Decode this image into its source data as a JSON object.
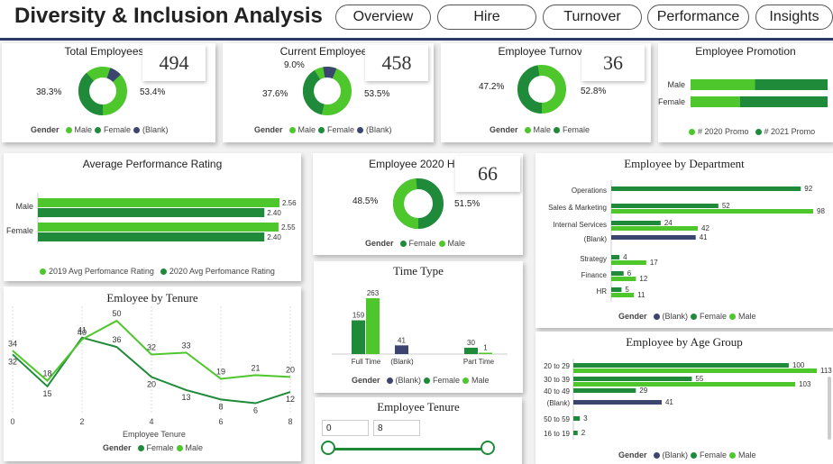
{
  "header": {
    "title": "Diversity & Inclusion Analysis",
    "tabs": [
      "Overview",
      "Hire",
      "Turnover",
      "Performance",
      "Insights"
    ]
  },
  "colors": {
    "male": "#4ec72d",
    "female": "#1f8a3a",
    "blank": "#3c4470",
    "header_line": "#2b3a67"
  },
  "total_employees": {
    "title": "Total Employees",
    "kpi": "494",
    "left_pct": "38.3%",
    "right_pct": "53.4%",
    "legend_title": "Gender",
    "legend": [
      "Male",
      "Female",
      "(Blank)"
    ]
  },
  "current_employees": {
    "title": "Current Employees",
    "kpi": "458",
    "top_pct": "9.0%",
    "left_pct": "37.6%",
    "right_pct": "53.5%",
    "legend_title": "Gender",
    "legend": [
      "Male",
      "Female",
      "(Blank)"
    ]
  },
  "employee_turnover": {
    "title": "Employee Turnover",
    "kpi": "36",
    "left_pct": "47.2%",
    "right_pct": "52.8%",
    "legend_title": "Gender",
    "legend": [
      "Male",
      "Female"
    ]
  },
  "employee_promotion": {
    "title": "Employee Promotion",
    "categories": [
      "Male",
      "Female"
    ],
    "legend": [
      "# 2020 Promo",
      "# 2021 Promo"
    ]
  },
  "avg_performance": {
    "title": "Average Performance Rating",
    "categories": [
      "Male",
      "Female"
    ],
    "legend": [
      "2019 Avg Perfomance Rating",
      "2020 Avg Perfomance Rating"
    ]
  },
  "employee_2020_hire": {
    "title": "Employee 2020 Hire",
    "kpi": "66",
    "left_pct": "48.5%",
    "right_pct": "51.5%",
    "legend_title": "Gender",
    "legend": [
      "Female",
      "Male"
    ]
  },
  "department": {
    "title": "Employee by Department",
    "legend_title": "Gender",
    "legend": [
      "(Blank)",
      "Female",
      "Male"
    ]
  },
  "tenure_chart": {
    "title": "Emloyee by Tenure",
    "xlabel": "Employee Tenure",
    "legend_title": "Gender",
    "legend": [
      "Female",
      "Male"
    ]
  },
  "time_type": {
    "title": "Time Type",
    "legend_title": "Gender",
    "legend": [
      "(Blank)",
      "Female",
      "Male"
    ]
  },
  "age_group": {
    "title": "Employee by Age Group",
    "legend_title": "Gender",
    "legend": [
      "(Blank)",
      "Female",
      "Male"
    ]
  },
  "tenure_slicer": {
    "title": "Employee Tenure",
    "min": "0",
    "max": "8"
  },
  "chart_data": [
    {
      "type": "bar",
      "orientation": "horizontal",
      "stacked": "100%",
      "categories": [
        "Male",
        "Female"
      ],
      "series": [
        {
          "name": "# 2020 Promo",
          "values": [
            0.47,
            0.36
          ]
        },
        {
          "name": "# 2021 Promo",
          "values": [
            0.53,
            0.64
          ]
        }
      ]
    },
    {
      "type": "bar",
      "orientation": "horizontal",
      "categories": [
        "Male",
        "Female"
      ],
      "series": [
        {
          "name": "2019 Avg Perfomance Rating",
          "values": [
            2.56,
            2.55
          ]
        },
        {
          "name": "2020 Avg Perfomance Rating",
          "values": [
            2.4,
            2.4
          ]
        }
      ]
    },
    {
      "type": "bar",
      "orientation": "horizontal",
      "categories": [
        "Operations",
        "Sales & Marketing",
        "Internal Services",
        "(Blank)",
        "Strategy",
        "Finance",
        "HR"
      ],
      "series": [
        {
          "name": "(Blank)",
          "values": [
            null,
            null,
            null,
            41,
            null,
            null,
            null
          ]
        },
        {
          "name": "Female",
          "values": [
            92,
            52,
            24,
            null,
            4,
            6,
            5
          ]
        },
        {
          "name": "Male",
          "values": [
            null,
            98,
            42,
            null,
            17,
            12,
            11
          ]
        }
      ]
    },
    {
      "type": "line",
      "x": [
        0,
        1,
        2,
        3,
        4,
        5,
        6,
        7,
        8
      ],
      "series": [
        {
          "name": "Female",
          "values": [
            32,
            15,
            41,
            36,
            20,
            13,
            8,
            6,
            12
          ]
        },
        {
          "name": "Male",
          "values": [
            34,
            18,
            40,
            50,
            32,
            33,
            19,
            21,
            20
          ]
        }
      ],
      "xlabel": "Employee Tenure",
      "xticks": [
        0,
        2,
        4,
        6,
        8
      ]
    },
    {
      "type": "bar",
      "categories": [
        "Full Time",
        "(Blank)",
        "Part Time"
      ],
      "series": [
        {
          "name": "(Blank)",
          "values": [
            null,
            41,
            null
          ]
        },
        {
          "name": "Female",
          "values": [
            159,
            null,
            30
          ]
        },
        {
          "name": "Male",
          "values": [
            263,
            null,
            1
          ]
        }
      ]
    },
    {
      "type": "bar",
      "orientation": "horizontal",
      "categories": [
        "20 to 29",
        "30 to 39",
        "40 to 49",
        "(Blank)",
        "50 to 59",
        "16 to 19"
      ],
      "series": [
        {
          "name": "(Blank)",
          "values": [
            null,
            null,
            null,
            41,
            null,
            null
          ]
        },
        {
          "name": "Female",
          "values": [
            100,
            55,
            29,
            null,
            3,
            2
          ]
        },
        {
          "name": "Male",
          "values": [
            113,
            103,
            null,
            null,
            null,
            null
          ]
        }
      ]
    }
  ]
}
